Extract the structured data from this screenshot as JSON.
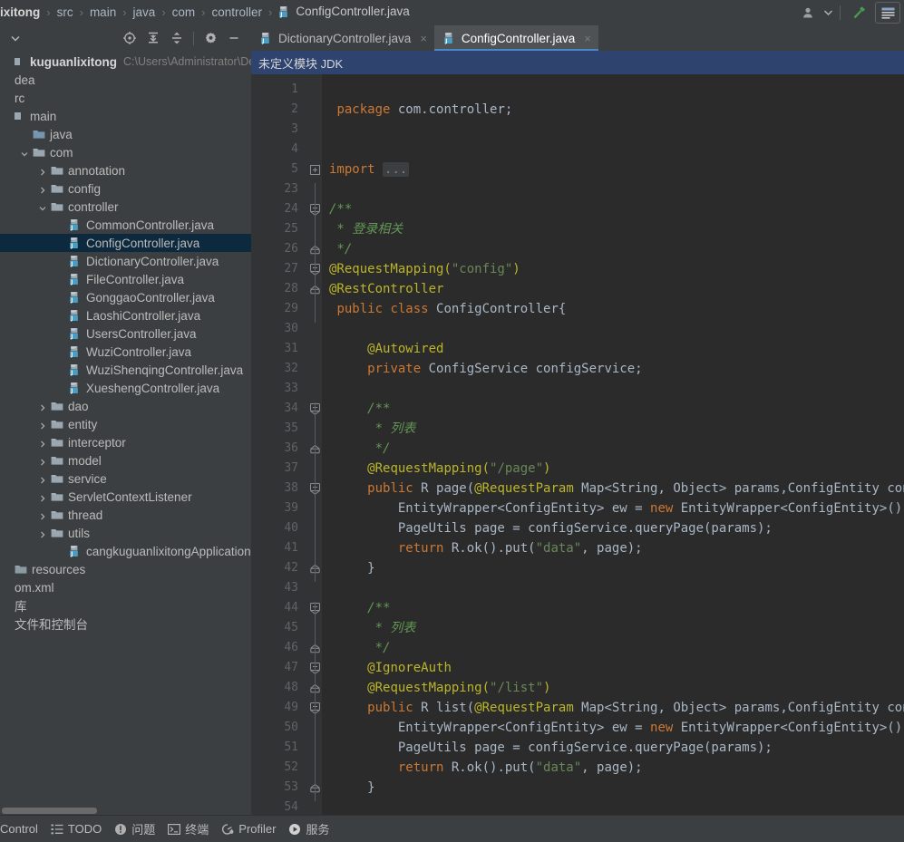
{
  "breadcrumb": {
    "items": [
      {
        "label": "ixitong",
        "icon": null
      },
      {
        "label": "src",
        "icon": null
      },
      {
        "label": "main",
        "icon": null
      },
      {
        "label": "java",
        "icon": null
      },
      {
        "label": "com",
        "icon": null
      },
      {
        "label": "controller",
        "icon": null
      },
      {
        "label": "ConfigController.java",
        "icon": "java-class-icon"
      }
    ],
    "separator": "›"
  },
  "topbar_right": {
    "account_icon": "user-avatar-icon",
    "account_dropdown_icon": "chevron-down-icon",
    "build_icon": "hammer-icon",
    "layout_icon": "window-layout-icon"
  },
  "sidebar": {
    "toolbar": {
      "dropdown_icon": "chevron-down-icon",
      "locate_icon": "select-opened-file-icon",
      "expand_icon": "expand-all-icon",
      "collapse_icon": "collapse-all-icon",
      "settings_icon": "gear-icon",
      "hide_icon": "minimize-icon"
    },
    "tree": [
      {
        "depth": 0,
        "label": "kuguanlixitong",
        "path": "C:\\Users\\Administrator\\Deskto",
        "icon": "project-icon",
        "arrow": "none",
        "type": "project",
        "selected": false
      },
      {
        "depth": 0,
        "label": "dea",
        "path": "",
        "icon": "none",
        "arrow": "none",
        "type": "folder-cut",
        "selected": false
      },
      {
        "depth": 0,
        "label": "rc",
        "path": "",
        "icon": "none",
        "arrow": "none",
        "type": "folder-cut",
        "selected": false
      },
      {
        "depth": 0,
        "label": "main",
        "path": "",
        "icon": "folder-partial",
        "arrow": "none",
        "type": "folder",
        "selected": false
      },
      {
        "depth": 1,
        "label": "java",
        "path": "",
        "icon": "folder-source",
        "arrow": "none",
        "type": "folder",
        "selected": false
      },
      {
        "depth": 1,
        "label": "com",
        "path": "",
        "icon": "folder",
        "arrow": "down",
        "type": "folder",
        "selected": false
      },
      {
        "depth": 2,
        "label": "annotation",
        "path": "",
        "icon": "folder",
        "arrow": "right",
        "type": "folder",
        "selected": false
      },
      {
        "depth": 2,
        "label": "config",
        "path": "",
        "icon": "folder",
        "arrow": "right",
        "type": "folder",
        "selected": false
      },
      {
        "depth": 2,
        "label": "controller",
        "path": "",
        "icon": "folder",
        "arrow": "down",
        "type": "folder",
        "selected": false
      },
      {
        "depth": 3,
        "label": "CommonController.java",
        "path": "",
        "icon": "java-class-icon",
        "arrow": "none",
        "type": "file",
        "selected": false
      },
      {
        "depth": 3,
        "label": "ConfigController.java",
        "path": "",
        "icon": "java-class-icon",
        "arrow": "none",
        "type": "file",
        "selected": true
      },
      {
        "depth": 3,
        "label": "DictionaryController.java",
        "path": "",
        "icon": "java-class-icon",
        "arrow": "none",
        "type": "file",
        "selected": false
      },
      {
        "depth": 3,
        "label": "FileController.java",
        "path": "",
        "icon": "java-class-icon",
        "arrow": "none",
        "type": "file",
        "selected": false
      },
      {
        "depth": 3,
        "label": "GonggaoController.java",
        "path": "",
        "icon": "java-class-icon",
        "arrow": "none",
        "type": "file",
        "selected": false
      },
      {
        "depth": 3,
        "label": "LaoshiController.java",
        "path": "",
        "icon": "java-class-icon",
        "arrow": "none",
        "type": "file",
        "selected": false
      },
      {
        "depth": 3,
        "label": "UsersController.java",
        "path": "",
        "icon": "java-class-icon",
        "arrow": "none",
        "type": "file",
        "selected": false
      },
      {
        "depth": 3,
        "label": "WuziController.java",
        "path": "",
        "icon": "java-class-icon",
        "arrow": "none",
        "type": "file",
        "selected": false
      },
      {
        "depth": 3,
        "label": "WuziShenqingController.java",
        "path": "",
        "icon": "java-class-icon",
        "arrow": "none",
        "type": "file",
        "selected": false
      },
      {
        "depth": 3,
        "label": "XueshengController.java",
        "path": "",
        "icon": "java-class-icon",
        "arrow": "none",
        "type": "file",
        "selected": false
      },
      {
        "depth": 2,
        "label": "dao",
        "path": "",
        "icon": "folder",
        "arrow": "right",
        "type": "folder",
        "selected": false
      },
      {
        "depth": 2,
        "label": "entity",
        "path": "",
        "icon": "folder",
        "arrow": "right",
        "type": "folder",
        "selected": false
      },
      {
        "depth": 2,
        "label": "interceptor",
        "path": "",
        "icon": "folder",
        "arrow": "right",
        "type": "folder",
        "selected": false
      },
      {
        "depth": 2,
        "label": "model",
        "path": "",
        "icon": "folder",
        "arrow": "right",
        "type": "folder",
        "selected": false
      },
      {
        "depth": 2,
        "label": "service",
        "path": "",
        "icon": "folder",
        "arrow": "right",
        "type": "folder",
        "selected": false
      },
      {
        "depth": 2,
        "label": "ServletContextListener",
        "path": "",
        "icon": "folder",
        "arrow": "right",
        "type": "folder",
        "selected": false
      },
      {
        "depth": 2,
        "label": "thread",
        "path": "",
        "icon": "folder",
        "arrow": "right",
        "type": "folder",
        "selected": false
      },
      {
        "depth": 2,
        "label": "utils",
        "path": "",
        "icon": "folder",
        "arrow": "right",
        "type": "folder",
        "selected": false
      },
      {
        "depth": 3,
        "label": "cangkuguanlixitongApplication.java",
        "path": "",
        "icon": "java-class-icon",
        "arrow": "none",
        "type": "file",
        "selected": false
      },
      {
        "depth": 0,
        "label": "resources",
        "path": "",
        "icon": "folder-resources",
        "arrow": "none",
        "type": "folder",
        "selected": false
      },
      {
        "depth": 0,
        "label": "om.xml",
        "path": "",
        "icon": "none",
        "arrow": "none",
        "type": "file-cut",
        "selected": false
      },
      {
        "depth": 0,
        "label": "库",
        "path": "",
        "icon": "none",
        "arrow": "none",
        "type": "file-cut",
        "selected": false
      },
      {
        "depth": 0,
        "label": "文件和控制台",
        "path": "",
        "icon": "none",
        "arrow": "none",
        "type": "file-cut",
        "selected": false
      }
    ]
  },
  "editor": {
    "tabs": [
      {
        "label": "DictionaryController.java",
        "icon": "java-class-icon",
        "active": false,
        "close": "×"
      },
      {
        "label": "ConfigController.java",
        "icon": "java-class-icon",
        "active": true,
        "close": "×"
      }
    ],
    "notice": "未定义模块 JDK",
    "lines": [
      {
        "num": "1",
        "fold": "",
        "tokens": []
      },
      {
        "num": "2",
        "fold": "",
        "tokens": [
          {
            "t": " ",
            "c": "pl"
          },
          {
            "t": "package",
            "c": "kw"
          },
          {
            "t": " com.controller;",
            "c": "pl"
          }
        ]
      },
      {
        "num": "3",
        "fold": "",
        "tokens": []
      },
      {
        "num": "4",
        "fold": "",
        "tokens": []
      },
      {
        "num": "5",
        "fold": "plus",
        "tokens": [
          {
            "t": "import",
            "c": "kw"
          },
          {
            "t": " ",
            "c": "pl"
          },
          {
            "t": "...",
            "c": "dots"
          }
        ]
      },
      {
        "num": "23",
        "fold": "",
        "tokens": []
      },
      {
        "num": "24",
        "fold": "open",
        "tokens": [
          {
            "t": "/**",
            "c": "cmt"
          }
        ]
      },
      {
        "num": "25",
        "fold": "",
        "tokens": [
          {
            "t": " * 登录相关",
            "c": "cmt"
          }
        ]
      },
      {
        "num": "26",
        "fold": "end",
        "tokens": [
          {
            "t": " */",
            "c": "cmt"
          }
        ]
      },
      {
        "num": "27",
        "fold": "open",
        "tokens": [
          {
            "t": "@RequestMapping(",
            "c": "ann"
          },
          {
            "t": "\"config\"",
            "c": "str"
          },
          {
            "t": ")",
            "c": "ann"
          }
        ]
      },
      {
        "num": "28",
        "fold": "end",
        "tokens": [
          {
            "t": "@RestController",
            "c": "ann"
          }
        ]
      },
      {
        "num": "29",
        "fold": "",
        "tokens": [
          {
            "t": " ",
            "c": "pl"
          },
          {
            "t": "public class",
            "c": "kw"
          },
          {
            "t": " ConfigController{",
            "c": "pl"
          }
        ]
      },
      {
        "num": "30",
        "fold": "",
        "tokens": []
      },
      {
        "num": "31",
        "fold": "",
        "tokens": [
          {
            "t": "     ",
            "c": "pl"
          },
          {
            "t": "@Autowired",
            "c": "ann"
          }
        ]
      },
      {
        "num": "32",
        "fold": "",
        "tokens": [
          {
            "t": "     ",
            "c": "pl"
          },
          {
            "t": "private",
            "c": "kw"
          },
          {
            "t": " ConfigService configService;",
            "c": "pl"
          }
        ]
      },
      {
        "num": "33",
        "fold": "",
        "tokens": []
      },
      {
        "num": "34",
        "fold": "open",
        "tokens": [
          {
            "t": "     /**",
            "c": "cmt"
          }
        ]
      },
      {
        "num": "35",
        "fold": "",
        "tokens": [
          {
            "t": "      * 列表",
            "c": "cmt"
          }
        ]
      },
      {
        "num": "36",
        "fold": "end",
        "tokens": [
          {
            "t": "      */",
            "c": "cmt"
          }
        ]
      },
      {
        "num": "37",
        "fold": "",
        "tokens": [
          {
            "t": "     ",
            "c": "pl"
          },
          {
            "t": "@RequestMapping(",
            "c": "ann"
          },
          {
            "t": "\"/page\"",
            "c": "str"
          },
          {
            "t": ")",
            "c": "ann"
          }
        ]
      },
      {
        "num": "38",
        "fold": "open",
        "tokens": [
          {
            "t": "     ",
            "c": "pl"
          },
          {
            "t": "public",
            "c": "kw"
          },
          {
            "t": " R page(",
            "c": "pl"
          },
          {
            "t": "@RequestParam",
            "c": "ann"
          },
          {
            "t": " Map<String, Object> params,ConfigEntity config){",
            "c": "pl"
          }
        ]
      },
      {
        "num": "39",
        "fold": "",
        "tokens": [
          {
            "t": "         EntityWrapper<ConfigEntity> ew = ",
            "c": "pl"
          },
          {
            "t": "new",
            "c": "kw"
          },
          {
            "t": " EntityWrapper<ConfigEntity>();",
            "c": "pl"
          }
        ]
      },
      {
        "num": "40",
        "fold": "",
        "tokens": [
          {
            "t": "         PageUtils page = configService.queryPage(params);",
            "c": "pl"
          }
        ]
      },
      {
        "num": "41",
        "fold": "",
        "tokens": [
          {
            "t": "         ",
            "c": "pl"
          },
          {
            "t": "return",
            "c": "kw"
          },
          {
            "t": " R.ok().put(",
            "c": "pl"
          },
          {
            "t": "\"data\"",
            "c": "str"
          },
          {
            "t": ", page);",
            "c": "pl"
          }
        ]
      },
      {
        "num": "42",
        "fold": "end",
        "tokens": [
          {
            "t": "     }",
            "c": "pl"
          }
        ]
      },
      {
        "num": "43",
        "fold": "",
        "tokens": []
      },
      {
        "num": "44",
        "fold": "open",
        "tokens": [
          {
            "t": "     /**",
            "c": "cmt"
          }
        ]
      },
      {
        "num": "45",
        "fold": "",
        "tokens": [
          {
            "t": "      * 列表",
            "c": "cmt"
          }
        ]
      },
      {
        "num": "46",
        "fold": "end",
        "tokens": [
          {
            "t": "      */",
            "c": "cmt"
          }
        ]
      },
      {
        "num": "47",
        "fold": "open",
        "tokens": [
          {
            "t": "     ",
            "c": "pl"
          },
          {
            "t": "@IgnoreAuth",
            "c": "ann"
          }
        ]
      },
      {
        "num": "48",
        "fold": "end",
        "tokens": [
          {
            "t": "     ",
            "c": "pl"
          },
          {
            "t": "@RequestMapping(",
            "c": "ann"
          },
          {
            "t": "\"/list\"",
            "c": "str"
          },
          {
            "t": ")",
            "c": "ann"
          }
        ]
      },
      {
        "num": "49",
        "fold": "open",
        "tokens": [
          {
            "t": "     ",
            "c": "pl"
          },
          {
            "t": "public",
            "c": "kw"
          },
          {
            "t": " R list(",
            "c": "pl"
          },
          {
            "t": "@RequestParam",
            "c": "ann"
          },
          {
            "t": " Map<String, Object> params,ConfigEntity config){",
            "c": "pl"
          }
        ]
      },
      {
        "num": "50",
        "fold": "",
        "tokens": [
          {
            "t": "         EntityWrapper<ConfigEntity> ew = ",
            "c": "pl"
          },
          {
            "t": "new",
            "c": "kw"
          },
          {
            "t": " EntityWrapper<ConfigEntity>();",
            "c": "pl"
          }
        ]
      },
      {
        "num": "51",
        "fold": "",
        "tokens": [
          {
            "t": "         PageUtils page = configService.queryPage(params);",
            "c": "pl"
          }
        ]
      },
      {
        "num": "52",
        "fold": "",
        "tokens": [
          {
            "t": "         ",
            "c": "pl"
          },
          {
            "t": "return",
            "c": "kw"
          },
          {
            "t": " R.ok().put(",
            "c": "pl"
          },
          {
            "t": "\"data\"",
            "c": "str"
          },
          {
            "t": ", page);",
            "c": "pl"
          }
        ]
      },
      {
        "num": "53",
        "fold": "end",
        "tokens": [
          {
            "t": "     }",
            "c": "pl"
          }
        ]
      },
      {
        "num": "54",
        "fold": "",
        "tokens": []
      }
    ]
  },
  "statusbar": {
    "items": [
      {
        "label": "Control",
        "icon": "none"
      },
      {
        "label": "TODO",
        "icon": "todo-list-icon"
      },
      {
        "label": "问题",
        "icon": "problems-icon"
      },
      {
        "label": "终端",
        "icon": "terminal-icon"
      },
      {
        "label": "Profiler",
        "icon": "profiler-icon"
      },
      {
        "label": "服务",
        "icon": "services-play-icon"
      }
    ]
  },
  "colors": {
    "chrome": "#3c3f41",
    "editor_bg": "#2b2b2b",
    "gutter_bg": "#313335",
    "selection": "#0d293e",
    "notice_bg": "#2e436e",
    "tab_active": "#4e5254",
    "accent": "#4a88c7",
    "text": "#bbbbbb",
    "keyword": "#cc7832",
    "string": "#6a8759",
    "comment": "#629755",
    "annotation": "#bbb529"
  }
}
